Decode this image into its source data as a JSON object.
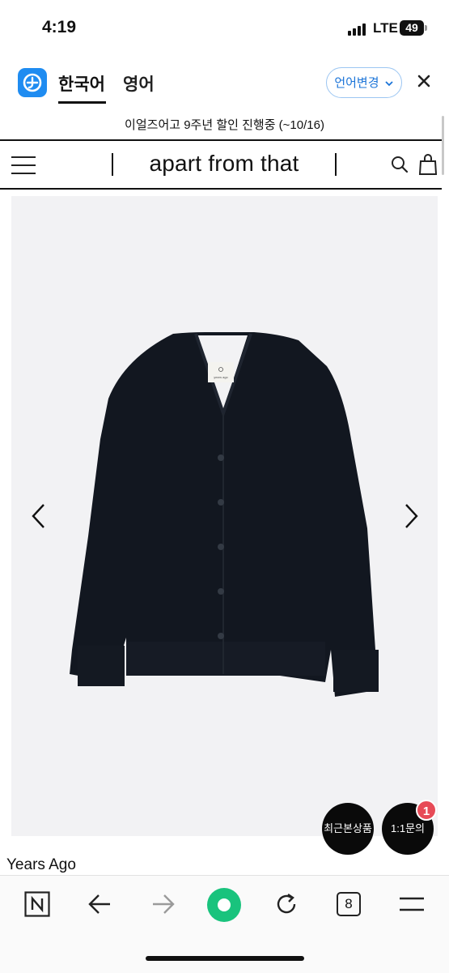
{
  "status_bar": {
    "time": "4:19",
    "network": "LTE",
    "battery": "49"
  },
  "translate_bar": {
    "language_tabs": [
      "한국어",
      "영어"
    ],
    "change_button": "언어변경",
    "close_icon": "close-icon"
  },
  "site": {
    "promo": "이얼즈어고 9주년 할인 진행중 (~10/16)",
    "brand": "apart from that",
    "label_text": "years ago"
  },
  "floating": {
    "recent_button": "최근본상품",
    "inquiry_button": "1:1문의",
    "inquiry_badge": "1"
  },
  "product": {
    "name": "Years Ago"
  },
  "browser_bar": {
    "tab_count": "8"
  },
  "colors": {
    "accent": "#1f8cf1",
    "badge": "#e74b57",
    "play": "#19c37d"
  }
}
